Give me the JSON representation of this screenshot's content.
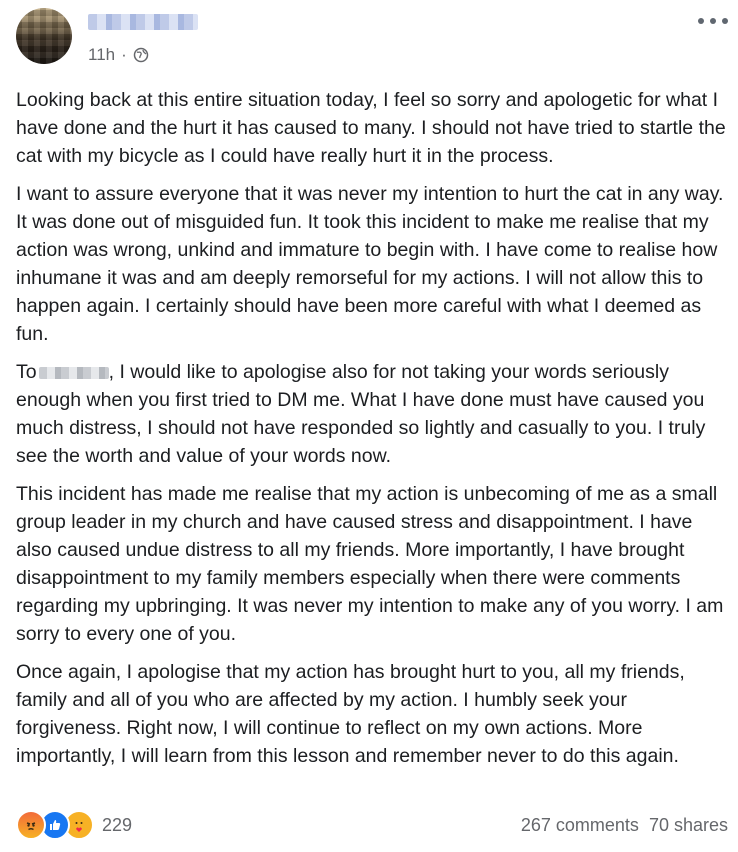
{
  "post": {
    "time": "11h",
    "dot": "·",
    "paragraphs": [
      "Looking back at this entire situation today, I feel so sorry and apologetic for what I have done and the hurt it has caused to many. I should not have tried to startle the cat with my bicycle as I could have really hurt it in the process.",
      "I want to assure everyone that it was never my intention to hurt the cat in any way. It was done out of misguided fun. It took this incident to make me realise that my action was wrong, unkind and immature to begin with. I have come to realise how inhumane it was and am deeply remorseful for my actions. I will not allow this to happen again. I certainly should have been more careful with what I deemed as fun.",
      "This incident has made me realise that my action is unbecoming of me as a small group leader in my church and have caused stress and disappointment. I have also caused undue distress to all my friends. More importantly, I have brought disappointment to my family members especially when there were comments regarding my upbringing. It was never my intention to make any of you worry. I am sorry to every one of you.",
      "Once again, I apologise that my action has brought hurt to you, all my friends, family and all of you who are affected by my action. I humbly seek your forgiveness. Right now, I will continue to reflect on my own actions. More importantly, I will learn from this lesson and remember never to do this again."
    ],
    "para3_prefix": "To",
    "para3_rest": ", I would like to apologise also for not taking your words seriously enough when you first tried to DM me. What I have done must have caused you much distress, I should not have responded so lightly and casually to you. I truly see the worth and value of your words now."
  },
  "footer": {
    "reaction_count": "229",
    "comments": "267 comments",
    "shares": "70 shares"
  },
  "icons": {
    "privacy": "globe-icon",
    "menu": "more-icon",
    "reactions": [
      "angry-reaction-icon",
      "like-reaction-icon",
      "care-reaction-icon"
    ]
  }
}
